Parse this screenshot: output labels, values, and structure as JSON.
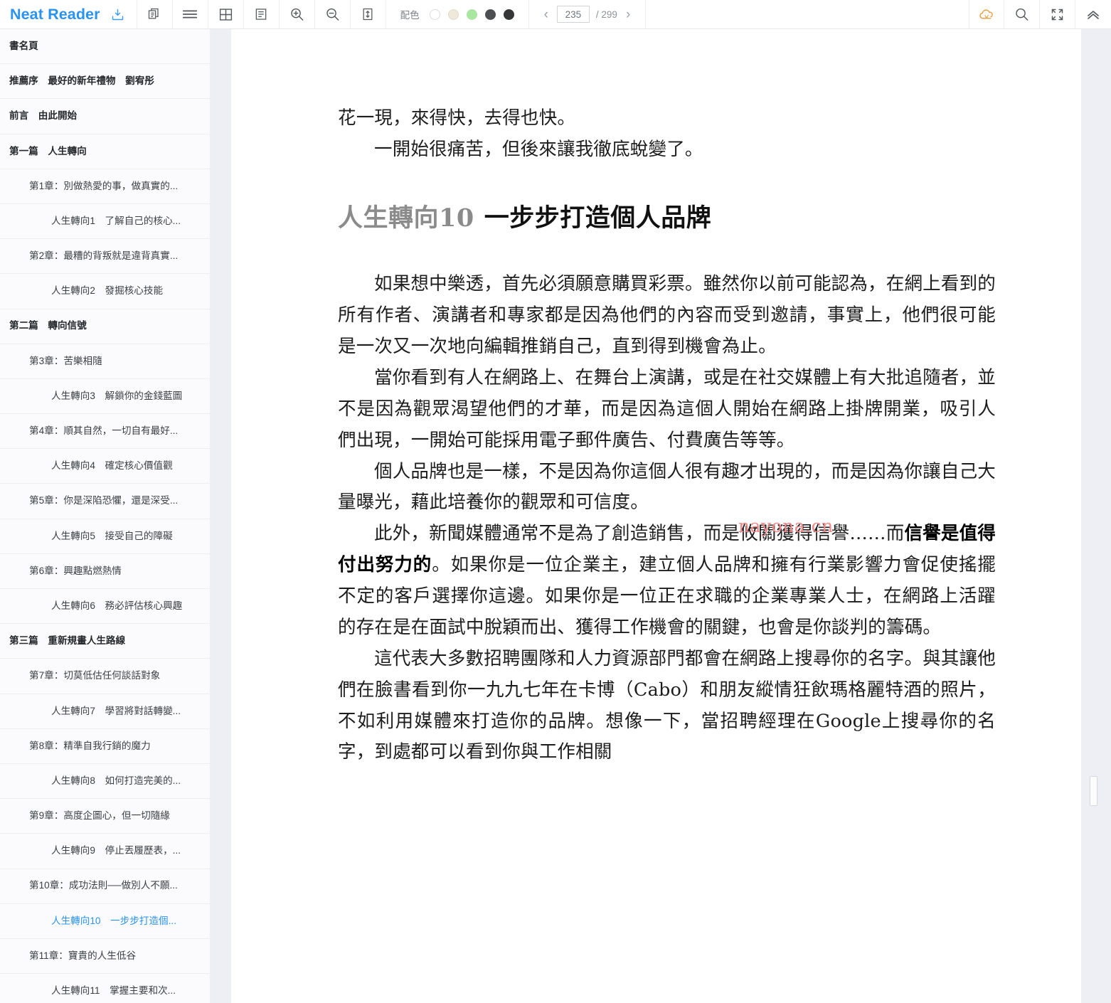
{
  "app": {
    "brand": "Neat Reader"
  },
  "toolbar": {
    "save_icon": "save-to-library-icon",
    "duplicate_icon": "duplicate-pages-icon",
    "menu_icon": "scroll-mode-icon",
    "grid_icon": "double-page-icon",
    "single_page_icon": "single-page-icon",
    "zoom_in_icon": "zoom-in-icon",
    "zoom_out_icon": "zoom-out-icon",
    "fit_height_icon": "fit-height-icon",
    "cloud_icon": "cloud-sync-icon",
    "search_icon": "search-icon",
    "fullscreen_icon": "fullscreen-icon",
    "collapse_icon": "collapse-toolbar-icon",
    "color_scheme_label": "配色",
    "color_swatches": [
      {
        "name": "white",
        "hex": "#ffffff"
      },
      {
        "name": "beige",
        "hex": "#efe9dc"
      },
      {
        "name": "green",
        "hex": "#a9e6a1"
      },
      {
        "name": "dark-gray",
        "hex": "#4c4f51"
      },
      {
        "name": "black",
        "hex": "#343638"
      }
    ],
    "selected_swatch": "white",
    "prev_page_label": "‹",
    "next_page_label": "›",
    "current_page": "235",
    "page_total": "/ 299"
  },
  "sidebar": {
    "items": [
      {
        "label": "書名頁",
        "level": 0,
        "active": false
      },
      {
        "label": "推薦序　最好的新年禮物　劉宥彤",
        "level": 0,
        "active": false
      },
      {
        "label": "前言　由此開始",
        "level": 0,
        "active": false
      },
      {
        "label": "第一篇　人生轉向",
        "level": 0,
        "active": false
      },
      {
        "label": "第1章：別做熱愛的事，做真實的...",
        "level": 1,
        "active": false
      },
      {
        "label": "人生轉向1　了解自己的核心...",
        "level": 2,
        "active": false
      },
      {
        "label": "第2章：最糟的背叛就是違背真實...",
        "level": 1,
        "active": false
      },
      {
        "label": "人生轉向2　發掘核心技能",
        "level": 2,
        "active": false
      },
      {
        "label": "第二篇　轉向信號",
        "level": 0,
        "active": false
      },
      {
        "label": "第3章：苦樂相隨",
        "level": 1,
        "active": false
      },
      {
        "label": "人生轉向3　解鎖你的金錢藍圖",
        "level": 2,
        "active": false
      },
      {
        "label": "第4章：順其自然，一切自有最好...",
        "level": 1,
        "active": false
      },
      {
        "label": "人生轉向4　確定核心價值觀",
        "level": 2,
        "active": false
      },
      {
        "label": "第5章：你是深陷恐懼，還是深受...",
        "level": 1,
        "active": false
      },
      {
        "label": "人生轉向5　接受自己的障礙",
        "level": 2,
        "active": false
      },
      {
        "label": "第6章：興趣點燃熱情",
        "level": 1,
        "active": false
      },
      {
        "label": "人生轉向6　務必評估核心興趣",
        "level": 2,
        "active": false
      },
      {
        "label": "第三篇　重新規畫人生路線",
        "level": 0,
        "active": false
      },
      {
        "label": "第7章：切莫低估任何談話對象",
        "level": 1,
        "active": false
      },
      {
        "label": "人生轉向7　學習將對話轉變...",
        "level": 2,
        "active": false
      },
      {
        "label": "第8章：精準自我行銷的魔力",
        "level": 1,
        "active": false
      },
      {
        "label": "人生轉向8　如何打造完美的...",
        "level": 2,
        "active": false
      },
      {
        "label": "第9章：高度企圖心，但一切隨緣",
        "level": 1,
        "active": false
      },
      {
        "label": "人生轉向9　停止丟履歷表，...",
        "level": 2,
        "active": false
      },
      {
        "label": "第10章：成功法則──做別人不願...",
        "level": 1,
        "active": false
      },
      {
        "label": "人生轉向10　一步步打造個...",
        "level": 2,
        "active": true
      },
      {
        "label": "第11章：寶貴的人生低谷",
        "level": 1,
        "active": false
      },
      {
        "label": "人生轉向11　掌握主要和次...",
        "level": 2,
        "active": false
      }
    ]
  },
  "content": {
    "lead_line_1": "花一現，來得快，去得也快。",
    "lead_line_2": "一開始很痛苦，但後來讓我徹底蛻變了。",
    "heading_number": "人生轉向10",
    "heading_title": "一步步打造個人品牌",
    "paragraphs": [
      "如果想中樂透，首先必須願意購買彩票。雖然你以前可能認為，在網上看到的所有作者、演講者和專家都是因為他們的內容而受到邀請，事實上，他們很可能是一次又一次地向編輯推銷自己，直到得到機會為止。",
      "當你看到有人在網路上、在舞台上演講，或是在社交媒體上有大批追隨者，並不是因為觀眾渴望他們的才華，而是因為這個人開始在網路上掛牌開業，吸引人們出現，一開始可能採用電子郵件廣告、付費廣告等等。",
      "個人品牌也是一樣，不是因為你這個人很有趣才出現的，而是因為你讓自己大量曝光，藉此培養你的觀眾和可信度。",
      "這代表大多數招聘團隊和人力資源部門都會在網路上搜尋你的名字。與其讓他們在臉書看到你一九九七年在卡博（Cabo）和朋友縱情狂飲瑪格麗特酒的照片，不如利用媒體來打造你的品牌。想像一下，當招聘經理在Google上搜尋你的名字，到處都可以看到你與工作相關"
    ],
    "mixed_paragraph": {
      "before": "此外，新聞媒體通常不是為了創造銷售，而是攸關獲得信譽……而",
      "bold": "信譽是值得付出努力的",
      "after": "。如果你是一位企業主，建立個人品牌和擁有行業影響力會促使搖擺不定的客戶選擇你這邊。如果你是一位正在求職的企業專業人士，在網路上活躍的存在是在面試中脫穎而出、獲得工作機會的關鍵，也會是你談判的籌碼。"
    },
    "watermark": "nayona.cn"
  }
}
